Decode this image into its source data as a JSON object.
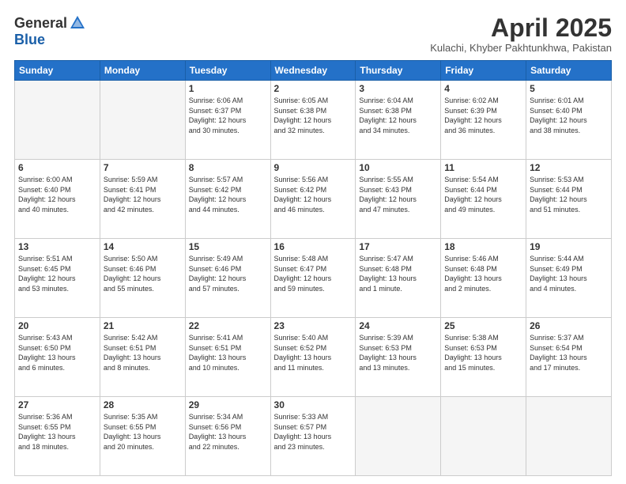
{
  "header": {
    "logo_general": "General",
    "logo_blue": "Blue",
    "title": "April 2025",
    "subtitle": "Kulachi, Khyber Pakhtunkhwa, Pakistan"
  },
  "days": [
    "Sunday",
    "Monday",
    "Tuesday",
    "Wednesday",
    "Thursday",
    "Friday",
    "Saturday"
  ],
  "weeks": [
    [
      {
        "day": "",
        "info": ""
      },
      {
        "day": "",
        "info": ""
      },
      {
        "day": "1",
        "info": "Sunrise: 6:06 AM\nSunset: 6:37 PM\nDaylight: 12 hours\nand 30 minutes."
      },
      {
        "day": "2",
        "info": "Sunrise: 6:05 AM\nSunset: 6:38 PM\nDaylight: 12 hours\nand 32 minutes."
      },
      {
        "day": "3",
        "info": "Sunrise: 6:04 AM\nSunset: 6:38 PM\nDaylight: 12 hours\nand 34 minutes."
      },
      {
        "day": "4",
        "info": "Sunrise: 6:02 AM\nSunset: 6:39 PM\nDaylight: 12 hours\nand 36 minutes."
      },
      {
        "day": "5",
        "info": "Sunrise: 6:01 AM\nSunset: 6:40 PM\nDaylight: 12 hours\nand 38 minutes."
      }
    ],
    [
      {
        "day": "6",
        "info": "Sunrise: 6:00 AM\nSunset: 6:40 PM\nDaylight: 12 hours\nand 40 minutes."
      },
      {
        "day": "7",
        "info": "Sunrise: 5:59 AM\nSunset: 6:41 PM\nDaylight: 12 hours\nand 42 minutes."
      },
      {
        "day": "8",
        "info": "Sunrise: 5:57 AM\nSunset: 6:42 PM\nDaylight: 12 hours\nand 44 minutes."
      },
      {
        "day": "9",
        "info": "Sunrise: 5:56 AM\nSunset: 6:42 PM\nDaylight: 12 hours\nand 46 minutes."
      },
      {
        "day": "10",
        "info": "Sunrise: 5:55 AM\nSunset: 6:43 PM\nDaylight: 12 hours\nand 47 minutes."
      },
      {
        "day": "11",
        "info": "Sunrise: 5:54 AM\nSunset: 6:44 PM\nDaylight: 12 hours\nand 49 minutes."
      },
      {
        "day": "12",
        "info": "Sunrise: 5:53 AM\nSunset: 6:44 PM\nDaylight: 12 hours\nand 51 minutes."
      }
    ],
    [
      {
        "day": "13",
        "info": "Sunrise: 5:51 AM\nSunset: 6:45 PM\nDaylight: 12 hours\nand 53 minutes."
      },
      {
        "day": "14",
        "info": "Sunrise: 5:50 AM\nSunset: 6:46 PM\nDaylight: 12 hours\nand 55 minutes."
      },
      {
        "day": "15",
        "info": "Sunrise: 5:49 AM\nSunset: 6:46 PM\nDaylight: 12 hours\nand 57 minutes."
      },
      {
        "day": "16",
        "info": "Sunrise: 5:48 AM\nSunset: 6:47 PM\nDaylight: 12 hours\nand 59 minutes."
      },
      {
        "day": "17",
        "info": "Sunrise: 5:47 AM\nSunset: 6:48 PM\nDaylight: 13 hours\nand 1 minute."
      },
      {
        "day": "18",
        "info": "Sunrise: 5:46 AM\nSunset: 6:48 PM\nDaylight: 13 hours\nand 2 minutes."
      },
      {
        "day": "19",
        "info": "Sunrise: 5:44 AM\nSunset: 6:49 PM\nDaylight: 13 hours\nand 4 minutes."
      }
    ],
    [
      {
        "day": "20",
        "info": "Sunrise: 5:43 AM\nSunset: 6:50 PM\nDaylight: 13 hours\nand 6 minutes."
      },
      {
        "day": "21",
        "info": "Sunrise: 5:42 AM\nSunset: 6:51 PM\nDaylight: 13 hours\nand 8 minutes."
      },
      {
        "day": "22",
        "info": "Sunrise: 5:41 AM\nSunset: 6:51 PM\nDaylight: 13 hours\nand 10 minutes."
      },
      {
        "day": "23",
        "info": "Sunrise: 5:40 AM\nSunset: 6:52 PM\nDaylight: 13 hours\nand 11 minutes."
      },
      {
        "day": "24",
        "info": "Sunrise: 5:39 AM\nSunset: 6:53 PM\nDaylight: 13 hours\nand 13 minutes."
      },
      {
        "day": "25",
        "info": "Sunrise: 5:38 AM\nSunset: 6:53 PM\nDaylight: 13 hours\nand 15 minutes."
      },
      {
        "day": "26",
        "info": "Sunrise: 5:37 AM\nSunset: 6:54 PM\nDaylight: 13 hours\nand 17 minutes."
      }
    ],
    [
      {
        "day": "27",
        "info": "Sunrise: 5:36 AM\nSunset: 6:55 PM\nDaylight: 13 hours\nand 18 minutes."
      },
      {
        "day": "28",
        "info": "Sunrise: 5:35 AM\nSunset: 6:55 PM\nDaylight: 13 hours\nand 20 minutes."
      },
      {
        "day": "29",
        "info": "Sunrise: 5:34 AM\nSunset: 6:56 PM\nDaylight: 13 hours\nand 22 minutes."
      },
      {
        "day": "30",
        "info": "Sunrise: 5:33 AM\nSunset: 6:57 PM\nDaylight: 13 hours\nand 23 minutes."
      },
      {
        "day": "",
        "info": ""
      },
      {
        "day": "",
        "info": ""
      },
      {
        "day": "",
        "info": ""
      }
    ]
  ]
}
